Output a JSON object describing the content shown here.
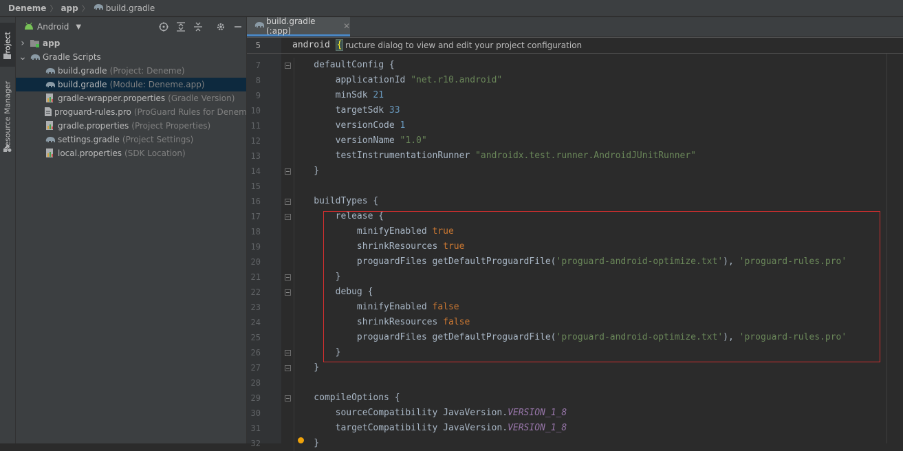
{
  "breadcrumb": {
    "items": [
      "Deneme",
      "app",
      "build.gradle"
    ]
  },
  "toolstrip": {
    "tabs": [
      "Project",
      "Resource Manager"
    ]
  },
  "project_panel": {
    "view_selector": "Android",
    "tree": [
      {
        "name": "app",
        "hint": "",
        "level": 0,
        "expand": "collapsed",
        "icon": "folder-module-icon",
        "bold": true
      },
      {
        "name": "Gradle Scripts",
        "hint": "",
        "level": 0,
        "expand": "expanded",
        "icon": "gradle-elephant-icon",
        "bold": false
      },
      {
        "name": "build.gradle",
        "hint": "(Project: Deneme)",
        "level": 1,
        "icon": "gradle-elephant-icon"
      },
      {
        "name": "build.gradle",
        "hint": "(Module: Deneme.app)",
        "level": 1,
        "icon": "gradle-elephant-icon",
        "selected": true
      },
      {
        "name": "gradle-wrapper.properties",
        "hint": "(Gradle Version)",
        "level": 1,
        "icon": "properties-file-icon"
      },
      {
        "name": "proguard-rules.pro",
        "hint": "(ProGuard Rules for Deneme.app)",
        "level": 1,
        "icon": "text-file-icon"
      },
      {
        "name": "gradle.properties",
        "hint": "(Project Properties)",
        "level": 1,
        "icon": "properties-file-icon"
      },
      {
        "name": "settings.gradle",
        "hint": "(Project Settings)",
        "level": 1,
        "icon": "gradle-elephant-icon"
      },
      {
        "name": "local.properties",
        "hint": "(SDK Location)",
        "level": 1,
        "icon": "properties-file-icon"
      }
    ]
  },
  "editor": {
    "tab_label": "build.gradle (:app)",
    "sticky": {
      "line_number": "5",
      "code": "android",
      "brace": "{",
      "tooltip": "ructure dialog to view and edit your project configuration"
    },
    "lines": [
      {
        "n": "7",
        "tokens": [
          [
            "ident",
            "    defaultConfig {"
          ]
        ]
      },
      {
        "n": "8",
        "tokens": [
          [
            "ident",
            "        applicationId "
          ],
          [
            "str",
            "\"net.r10.android\""
          ]
        ]
      },
      {
        "n": "9",
        "tokens": [
          [
            "ident",
            "        minSdk "
          ],
          [
            "num",
            "21"
          ]
        ]
      },
      {
        "n": "10",
        "tokens": [
          [
            "ident",
            "        targetSdk "
          ],
          [
            "num",
            "33"
          ]
        ]
      },
      {
        "n": "11",
        "tokens": [
          [
            "ident",
            "        versionCode "
          ],
          [
            "num",
            "1"
          ]
        ]
      },
      {
        "n": "12",
        "tokens": [
          [
            "ident",
            "        versionName "
          ],
          [
            "str",
            "\"1.0\""
          ]
        ]
      },
      {
        "n": "13",
        "tokens": [
          [
            "ident",
            "        testInstrumentationRunner "
          ],
          [
            "str",
            "\"androidx.test.runner.AndroidJUnitRunner\""
          ]
        ]
      },
      {
        "n": "14",
        "tokens": [
          [
            "ident",
            "    }"
          ]
        ]
      },
      {
        "n": "15",
        "tokens": [
          [
            "ident",
            ""
          ]
        ]
      },
      {
        "n": "16",
        "tokens": [
          [
            "ident",
            "    buildTypes {"
          ]
        ]
      },
      {
        "n": "17",
        "tokens": [
          [
            "ident",
            "        release {"
          ]
        ]
      },
      {
        "n": "18",
        "tokens": [
          [
            "ident",
            "            minifyEnabled "
          ],
          [
            "kw",
            "true"
          ]
        ]
      },
      {
        "n": "19",
        "tokens": [
          [
            "ident",
            "            shrinkResources "
          ],
          [
            "kw",
            "true"
          ]
        ]
      },
      {
        "n": "20",
        "tokens": [
          [
            "ident",
            "            proguardFiles getDefaultProguardFile("
          ],
          [
            "str",
            "'proguard-android-optimize.txt'"
          ],
          [
            "ident",
            "), "
          ],
          [
            "str",
            "'proguard-rules.pro'"
          ]
        ]
      },
      {
        "n": "21",
        "tokens": [
          [
            "ident",
            "        }"
          ]
        ]
      },
      {
        "n": "22",
        "tokens": [
          [
            "ident",
            "        debug {"
          ]
        ]
      },
      {
        "n": "23",
        "tokens": [
          [
            "ident",
            "            minifyEnabled "
          ],
          [
            "kw",
            "false"
          ]
        ]
      },
      {
        "n": "24",
        "tokens": [
          [
            "ident",
            "            shrinkResources "
          ],
          [
            "kw",
            "false"
          ]
        ]
      },
      {
        "n": "25",
        "tokens": [
          [
            "ident",
            "            proguardFiles getDefaultProguardFile("
          ],
          [
            "str",
            "'proguard-android-optimize.txt'"
          ],
          [
            "ident",
            "), "
          ],
          [
            "str",
            "'proguard-rules.pro'"
          ]
        ]
      },
      {
        "n": "26",
        "tokens": [
          [
            "ident",
            "        }"
          ]
        ]
      },
      {
        "n": "27",
        "tokens": [
          [
            "ident",
            "    }"
          ]
        ]
      },
      {
        "n": "28",
        "tokens": [
          [
            "ident",
            ""
          ]
        ]
      },
      {
        "n": "29",
        "tokens": [
          [
            "ident",
            "    compileOptions {"
          ]
        ]
      },
      {
        "n": "30",
        "tokens": [
          [
            "ident",
            "        sourceCompatibility JavaVersion."
          ],
          [
            "const",
            "VERSION_1_8"
          ]
        ]
      },
      {
        "n": "31",
        "tokens": [
          [
            "ident",
            "        targetCompatibility JavaVersion."
          ],
          [
            "const",
            "VERSION_1_8"
          ]
        ]
      },
      {
        "n": "32",
        "tokens": [
          [
            "ident",
            "    }"
          ]
        ]
      }
    ]
  },
  "colors": {
    "highlight_box": "#d32f2f",
    "selection": "#0d293e",
    "tab_underline": "#4a88c7"
  }
}
